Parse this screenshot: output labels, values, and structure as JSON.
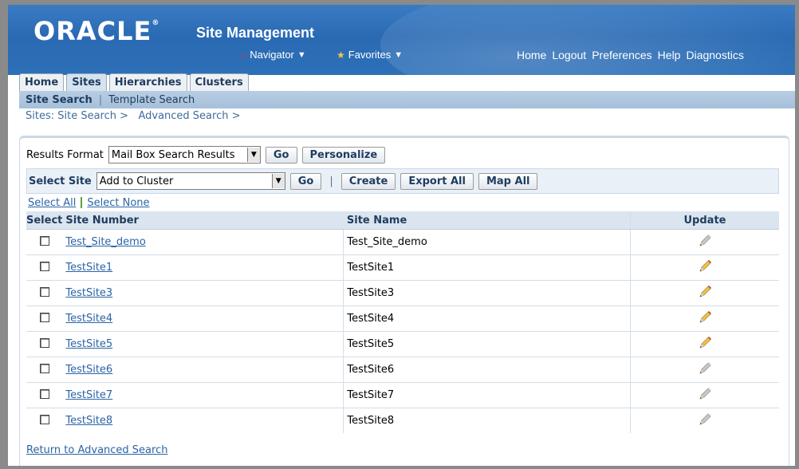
{
  "header": {
    "logo": "ORACLE",
    "app_title": "Site Management",
    "navigator_label": "Navigator",
    "favorites_label": "Favorites",
    "global_links": [
      "Home",
      "Logout",
      "Preferences",
      "Help",
      "Diagnostics"
    ]
  },
  "tabs": [
    {
      "label": "Home",
      "active": false
    },
    {
      "label": "Sites",
      "active": true
    },
    {
      "label": "Hierarchies",
      "active": false
    },
    {
      "label": "Clusters",
      "active": false
    }
  ],
  "subtabs": {
    "site_search": "Site Search",
    "template_search": "Template Search",
    "separator": "|"
  },
  "breadcrumb": {
    "item1": "Sites: Site Search",
    "item2": "Advanced Search",
    "sep": ">"
  },
  "results": {
    "format_label": "Results Format",
    "format_value": "Mail Box Search Results",
    "go_label": "Go",
    "personalize_label": "Personalize"
  },
  "actions": {
    "select_site_label": "Select Site",
    "select_site_value": "Add to Cluster",
    "go_label": "Go",
    "separator": "|",
    "create_label": "Create",
    "export_all_label": "Export All",
    "map_all_label": "Map All"
  },
  "select_links": {
    "all": "Select All",
    "none": "Select None"
  },
  "table": {
    "headers": {
      "select": "Select",
      "site_number": "Site Number",
      "site_name": "Site Name",
      "update": "Update"
    },
    "rows": [
      {
        "number": "Test_Site_demo",
        "name": "Test_Site_demo",
        "update_enabled": false
      },
      {
        "number": "TestSite1",
        "name": "TestSite1",
        "update_enabled": true
      },
      {
        "number": "TestSite3",
        "name": "TestSite3",
        "update_enabled": true
      },
      {
        "number": "TestSite4",
        "name": "TestSite4",
        "update_enabled": true
      },
      {
        "number": "TestSite5",
        "name": "TestSite5",
        "update_enabled": true
      },
      {
        "number": "TestSite6",
        "name": "TestSite6",
        "update_enabled": false
      },
      {
        "number": "TestSite7",
        "name": "TestSite7",
        "update_enabled": false
      },
      {
        "number": "TestSite8",
        "name": "TestSite8",
        "update_enabled": false
      }
    ]
  },
  "return_link": "Return to Advanced Search",
  "colors": {
    "header_blue": "#2d70b8",
    "link_blue": "#2a64a6",
    "pencil_active": "#f2c230",
    "pencil_disabled": "#c8c8c8"
  }
}
